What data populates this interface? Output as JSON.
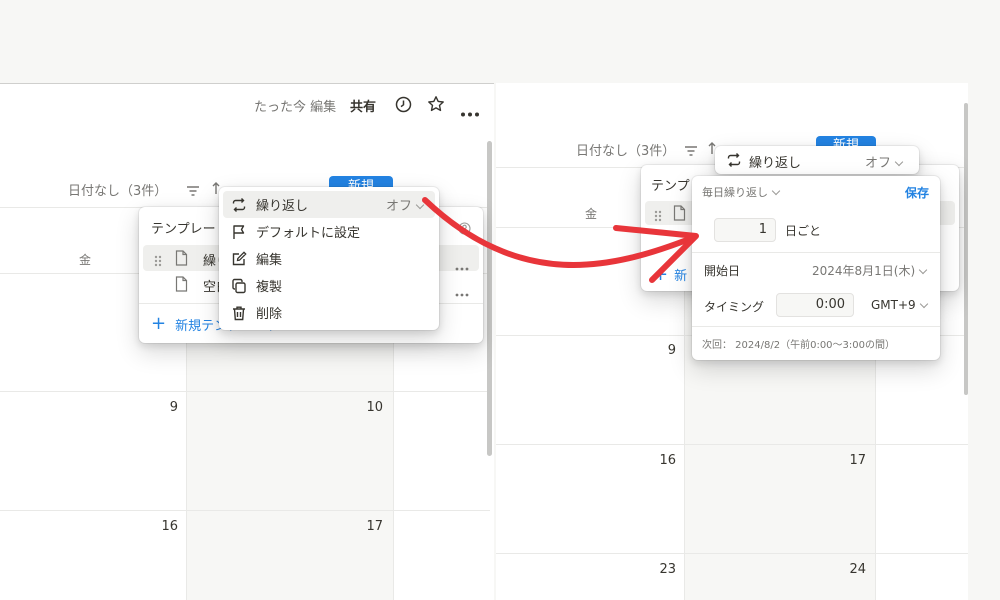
{
  "left": {
    "header": {
      "edited": "たった今 編集",
      "share": "共有"
    },
    "view_title": "日付なし（3件）",
    "new_button": "新規",
    "day_header": "金",
    "template_panel": {
      "title": "テンプレート",
      "items": [
        {
          "label": "繰り返し"
        },
        {
          "label": "空白"
        }
      ],
      "new_template": "新規テンプレート"
    },
    "context_menu": {
      "items": [
        {
          "label": "繰り返し",
          "value": "オフ"
        },
        {
          "label": "デフォルトに設定"
        },
        {
          "label": "編集"
        },
        {
          "label": "複製"
        },
        {
          "label": "削除"
        }
      ]
    },
    "dates": [
      "9",
      "10",
      "16",
      "17"
    ]
  },
  "right": {
    "view_title": "日付なし（3件）",
    "new_button": "新規",
    "day_header": "金",
    "template_title": "テンプレ",
    "new_template": "新",
    "repeat_header": {
      "label": "繰り返し",
      "value": "オフ"
    },
    "repeat_dialog": {
      "frequency": "毎日繰り返し",
      "save": "保存",
      "interval_value": "1",
      "interval_unit": "日ごと",
      "start_label": "開始日",
      "start_value": "2024年8月1日(木)",
      "timing_label": "タイミング",
      "time_value": "0:00",
      "timezone": "GMT+9",
      "next_run": "次回： 2024/8/2（午前0:00〜3:00の間）"
    },
    "dates": [
      "9",
      "16",
      "17",
      "23",
      "24"
    ]
  },
  "colors": {
    "accent": "#2383e2",
    "arrow": "#e8353a",
    "grid": "#e9e9e7",
    "highlight": "#f7f7f5"
  }
}
